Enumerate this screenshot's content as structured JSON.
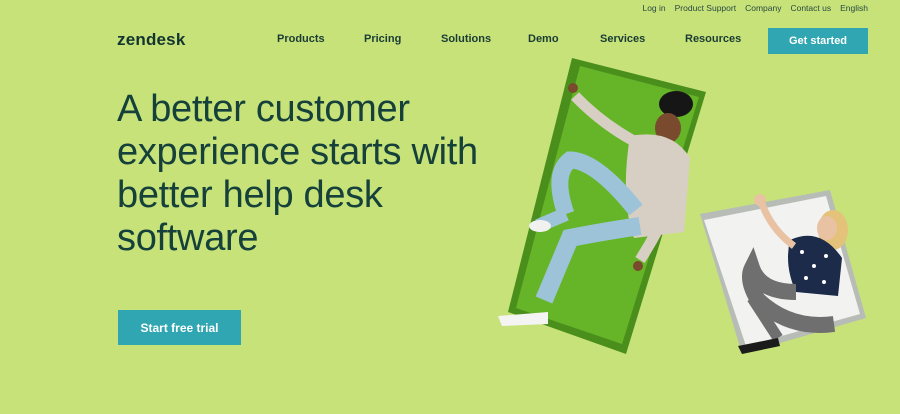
{
  "utility_nav": [
    "Log in",
    "Product Support",
    "Company",
    "Contact us",
    "English"
  ],
  "brand": {
    "logo_text": "zendesk"
  },
  "main_nav": [
    {
      "label": "Products"
    },
    {
      "label": "Pricing"
    },
    {
      "label": "Solutions"
    },
    {
      "label": "Demo"
    },
    {
      "label": "Services"
    },
    {
      "label": "Resources"
    }
  ],
  "header_cta": "Get started",
  "hero": {
    "title": "A better customer experience starts with better help desk software",
    "cta": "Start free trial"
  },
  "colors": {
    "background": "#c7e279",
    "accent": "#2fa6b1",
    "text": "#15413a",
    "frame_green": "#69b82a"
  }
}
